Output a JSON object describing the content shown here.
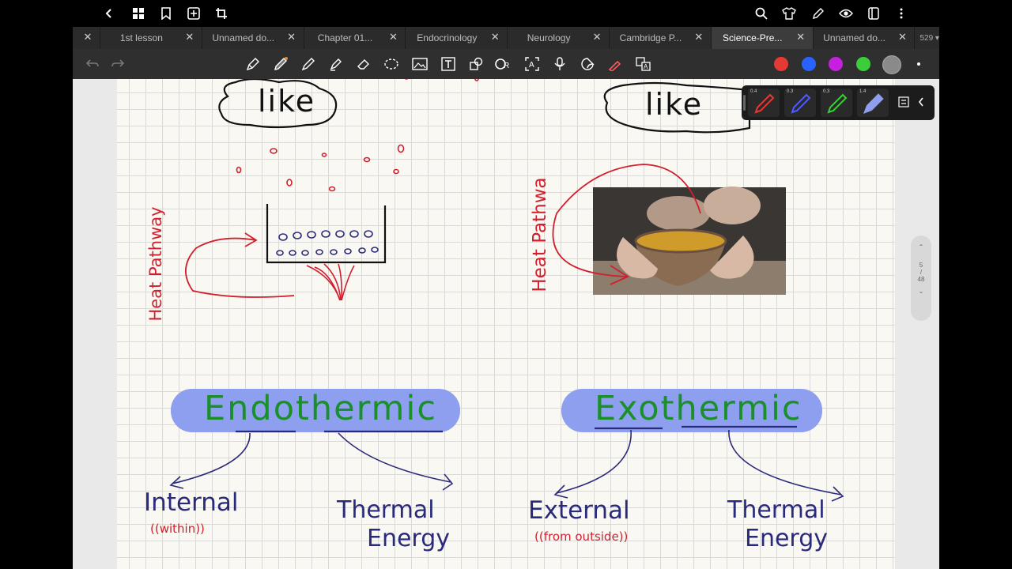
{
  "topbar": {
    "back_icon": "chevron-left-icon",
    "grid_icon": "grid-icon",
    "bookmark_icon": "bookmark-icon",
    "add_page_icon": "add-page-icon",
    "crop_icon": "crop-icon",
    "search_icon": "search-icon",
    "shirt_icon": "shirt-icon",
    "edit_icon": "pen-edit-icon",
    "view_icon": "eye-icon",
    "panel_icon": "panel-icon",
    "more_icon": "more-vertical-icon"
  },
  "tabs": [
    {
      "label": "1st lesson",
      "active": false
    },
    {
      "label": "Unnamed do...",
      "active": false
    },
    {
      "label": "Chapter 01...",
      "active": false
    },
    {
      "label": "Endocrinology",
      "active": false
    },
    {
      "label": "Neurology",
      "active": false
    },
    {
      "label": "Cambridge P...",
      "active": false
    },
    {
      "label": "Science-Pre...",
      "active": true
    },
    {
      "label": "Unnamed do...",
      "active": false
    }
  ],
  "tab_count": "529",
  "colors": {
    "red": "#e53935",
    "blue": "#2962ff",
    "purple": "#c51fe0",
    "green": "#3ccd3c",
    "gray": "#9e9e9e",
    "highlight": "#8e9ff0",
    "ink_red": "#d21f2e",
    "ink_green": "#1a8f2a",
    "ink_navy": "#2a2a7a"
  },
  "pens": [
    {
      "size": "0.4",
      "color": "#e53935"
    },
    {
      "size": "0.3",
      "color": "#4d5cff"
    },
    {
      "size": "0.3",
      "color": "#3ccd3c"
    },
    {
      "size": "1.4",
      "color": "#8e9ff0"
    }
  ],
  "pager": {
    "current": "5",
    "sep": "/",
    "total": "48"
  },
  "notes": {
    "like_left": "like",
    "like_right": "like",
    "heat_left": "Heat Pathway",
    "heat_right": "Heat Pathwa",
    "endothermic": "Endothermic",
    "exothermic": "Exothermic",
    "internal": "Internal",
    "within": "((within))",
    "thermal_energy_1": "Thermal",
    "thermal_energy_1b": "Energy",
    "external": "External",
    "from_outside": "((from outside))",
    "thermal_energy_2": "Thermal",
    "thermal_energy_2b": "Energy"
  }
}
